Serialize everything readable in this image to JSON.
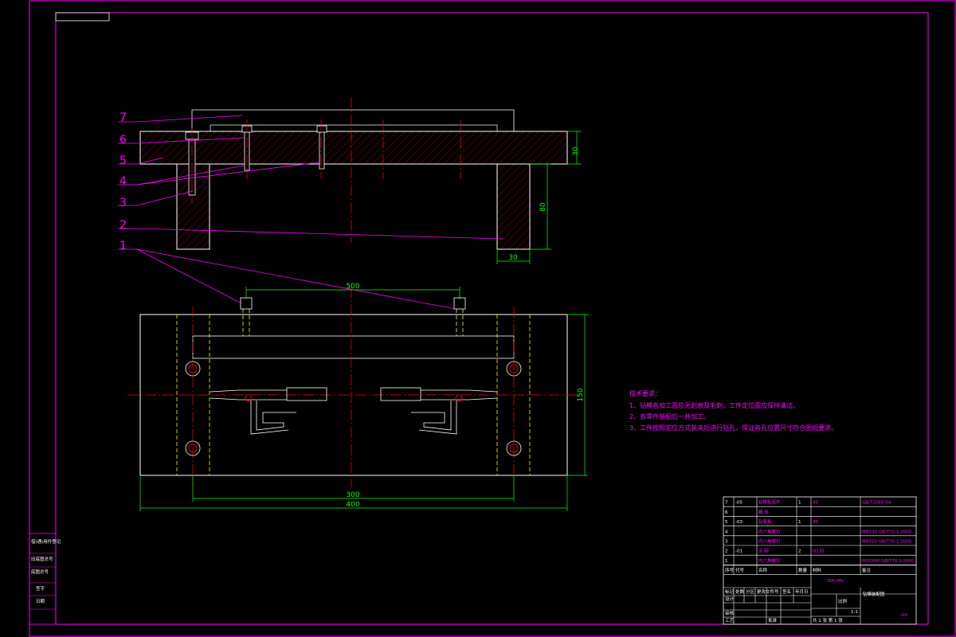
{
  "colors": {
    "background": "#000000",
    "frame": "#ff00ff",
    "outline": "#ffffff",
    "hatch": "#ff0000",
    "centerline": "#ff0000",
    "dimension": "#00ff00",
    "hidden": "#ffff00",
    "leader": "#ff00ff"
  },
  "callouts": [
    "7",
    "6",
    "5",
    "4",
    "3",
    "2",
    "1"
  ],
  "dimensions": {
    "plate_thickness": "30",
    "leg_height": "80",
    "leg_width": "30",
    "bolt_pitch": "500",
    "plate_depth": "150",
    "leg_spacing": "300",
    "plate_length": "400"
  },
  "notes": {
    "title": "技术要求：",
    "items": [
      "1、钻模各加工面应无划痕及毛刺，工件定位面应保持清洁。",
      "2、各零件装配后一并加工。",
      "3、工件按照定位方式装夹后进行钻孔，保证各孔位置尺寸符合图纸要求。"
    ]
  },
  "parts_list": [
    {
      "no": "7",
      "code": "-05",
      "name": "钻模板组件",
      "qty": "1",
      "material": "45",
      "std": "GB/T2089-94"
    },
    {
      "no": "6",
      "code": "",
      "name": "螺 母",
      "qty": "",
      "material": "",
      "std": ""
    },
    {
      "no": "5",
      "code": "-03",
      "name": "钻套板",
      "qty": "1",
      "material": "45",
      "std": ""
    },
    {
      "no": "4",
      "code": "",
      "name": "内六角螺钉",
      "qty": "",
      "material": "",
      "std": "M8X30 GB/T70.1-2000"
    },
    {
      "no": "3",
      "code": "",
      "name": "内六角螺钉",
      "qty": "",
      "material": "",
      "std": "M6X20 GB/T70.1-2000"
    },
    {
      "no": "2",
      "code": "-01",
      "name": "支 脚",
      "qty": "2",
      "material": "Q235",
      "std": ""
    },
    {
      "no": "1",
      "code": "",
      "name": "内六角螺钉",
      "qty": "",
      "material": "",
      "std": "M10X40 GB/T70.1-2000"
    }
  ],
  "parts_header": {
    "no": "序号",
    "code": "代号",
    "name": "名称",
    "qty": "数量",
    "material": "材料",
    "std": "备注"
  },
  "title_block": {
    "scale_label": "比例",
    "scale_value": "1:1",
    "drawing_name": "钻模装配图",
    "material_mark": "30CrMn",
    "sheet": "共 1 张 第 1 张",
    "drawing_no": "-00",
    "design_label": "设计",
    "check_label": "审核",
    "process_label": "工艺",
    "approve_label": "批准",
    "mark_labels": [
      "标记",
      "处数",
      "分区",
      "更改文件号",
      "签名",
      "年月日"
    ]
  },
  "side_strip": [
    "借(通)用件登记",
    "旧底图总号",
    "底图总号",
    "签字",
    "日期"
  ]
}
